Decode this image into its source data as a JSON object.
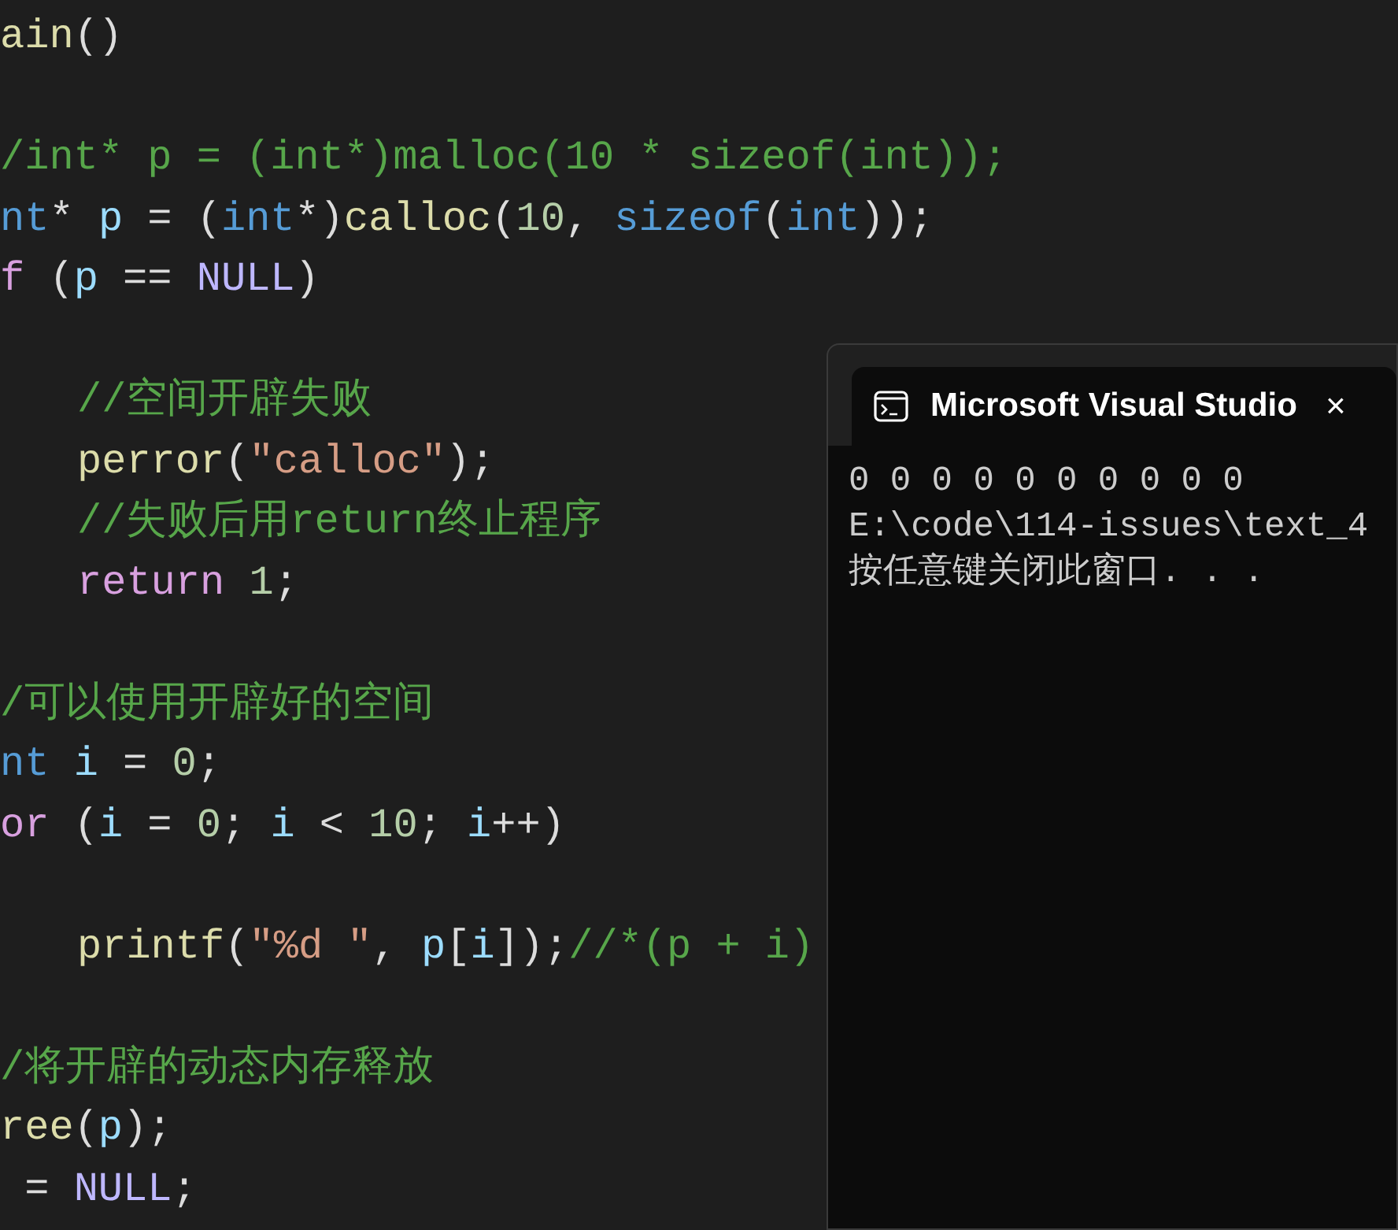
{
  "editor": {
    "lines": [
      {
        "kind": "code",
        "indented": false,
        "tokens": [
          {
            "text": "ain",
            "kind": "function"
          },
          {
            "text": "()",
            "kind": "plain"
          }
        ]
      },
      {
        "kind": "blank"
      },
      {
        "kind": "code",
        "indented": false,
        "tokens": [
          {
            "text": "/int* p = (int*)malloc(10 * sizeof(int));",
            "kind": "comment"
          }
        ]
      },
      {
        "kind": "code",
        "indented": false,
        "tokens": [
          {
            "text": "nt",
            "kind": "keyword"
          },
          {
            "text": "* ",
            "kind": "plain"
          },
          {
            "text": "p",
            "kind": "variable"
          },
          {
            "text": " = (",
            "kind": "plain"
          },
          {
            "text": "int",
            "kind": "keyword"
          },
          {
            "text": "*)",
            "kind": "plain"
          },
          {
            "text": "calloc",
            "kind": "function"
          },
          {
            "text": "(",
            "kind": "plain"
          },
          {
            "text": "10",
            "kind": "number"
          },
          {
            "text": ", ",
            "kind": "plain"
          },
          {
            "text": "sizeof",
            "kind": "keyword"
          },
          {
            "text": "(",
            "kind": "plain"
          },
          {
            "text": "int",
            "kind": "keyword"
          },
          {
            "text": "));",
            "kind": "plain"
          }
        ]
      },
      {
        "kind": "code",
        "indented": false,
        "tokens": [
          {
            "text": "f",
            "kind": "control"
          },
          {
            "text": " (",
            "kind": "plain"
          },
          {
            "text": "p",
            "kind": "variable"
          },
          {
            "text": " == ",
            "kind": "plain"
          },
          {
            "text": "NULL",
            "kind": "macro"
          },
          {
            "text": ")",
            "kind": "plain"
          }
        ]
      },
      {
        "kind": "blank"
      },
      {
        "kind": "code",
        "indented": true,
        "tokens": [
          {
            "text": "//空间开辟失败",
            "kind": "comment"
          }
        ]
      },
      {
        "kind": "code",
        "indented": true,
        "tokens": [
          {
            "text": "perror",
            "kind": "function"
          },
          {
            "text": "(",
            "kind": "plain"
          },
          {
            "text": "\"calloc\"",
            "kind": "string"
          },
          {
            "text": ");",
            "kind": "plain"
          }
        ]
      },
      {
        "kind": "code",
        "indented": true,
        "tokens": [
          {
            "text": "//失败后用return终止程序",
            "kind": "comment"
          }
        ]
      },
      {
        "kind": "code",
        "indented": true,
        "tokens": [
          {
            "text": "return",
            "kind": "control"
          },
          {
            "text": " 1",
            "kind": "number"
          },
          {
            "text": ";",
            "kind": "plain"
          }
        ]
      },
      {
        "kind": "blank"
      },
      {
        "kind": "code",
        "indented": false,
        "tokens": [
          {
            "text": "/可以使用开辟好的空间",
            "kind": "comment"
          }
        ]
      },
      {
        "kind": "code",
        "indented": false,
        "tokens": [
          {
            "text": "nt",
            "kind": "keyword"
          },
          {
            "text": " i",
            "kind": "variable"
          },
          {
            "text": " = ",
            "kind": "plain"
          },
          {
            "text": "0",
            "kind": "number"
          },
          {
            "text": ";",
            "kind": "plain"
          }
        ]
      },
      {
        "kind": "code",
        "indented": false,
        "tokens": [
          {
            "text": "or",
            "kind": "control"
          },
          {
            "text": " (",
            "kind": "plain"
          },
          {
            "text": "i",
            "kind": "variable"
          },
          {
            "text": " = ",
            "kind": "plain"
          },
          {
            "text": "0",
            "kind": "number"
          },
          {
            "text": "; ",
            "kind": "plain"
          },
          {
            "text": "i",
            "kind": "variable"
          },
          {
            "text": " < ",
            "kind": "plain"
          },
          {
            "text": "10",
            "kind": "number"
          },
          {
            "text": "; ",
            "kind": "plain"
          },
          {
            "text": "i",
            "kind": "variable"
          },
          {
            "text": "++)",
            "kind": "plain"
          }
        ]
      },
      {
        "kind": "blank"
      },
      {
        "kind": "code",
        "indented": true,
        "tokens": [
          {
            "text": "printf",
            "kind": "function"
          },
          {
            "text": "(",
            "kind": "plain"
          },
          {
            "text": "\"%d \"",
            "kind": "string"
          },
          {
            "text": ", ",
            "kind": "plain"
          },
          {
            "text": "p",
            "kind": "variable"
          },
          {
            "text": "[",
            "kind": "plain"
          },
          {
            "text": "i",
            "kind": "variable"
          },
          {
            "text": "]);",
            "kind": "plain"
          },
          {
            "text": "//*(p + i)",
            "kind": "comment"
          }
        ]
      },
      {
        "kind": "blank"
      },
      {
        "kind": "code",
        "indented": false,
        "tokens": [
          {
            "text": "/将开辟的动态内存释放",
            "kind": "comment"
          }
        ]
      },
      {
        "kind": "code",
        "indented": false,
        "tokens": [
          {
            "text": "ree",
            "kind": "function"
          },
          {
            "text": "(",
            "kind": "plain"
          },
          {
            "text": "p",
            "kind": "variable"
          },
          {
            "text": ");",
            "kind": "plain"
          }
        ]
      },
      {
        "kind": "code",
        "indented": false,
        "tokens": [
          {
            "text": " = ",
            "kind": "plain"
          },
          {
            "text": "NULL",
            "kind": "macro"
          },
          {
            "text": ";",
            "kind": "plain"
          }
        ]
      }
    ]
  },
  "console": {
    "title": "Microsoft Visual Studio",
    "close": "×",
    "output": [
      "0 0 0 0 0 0 0 0 0 0",
      "E:\\code\\114-issues\\text_4",
      "按任意键关闭此窗口. . ."
    ]
  }
}
